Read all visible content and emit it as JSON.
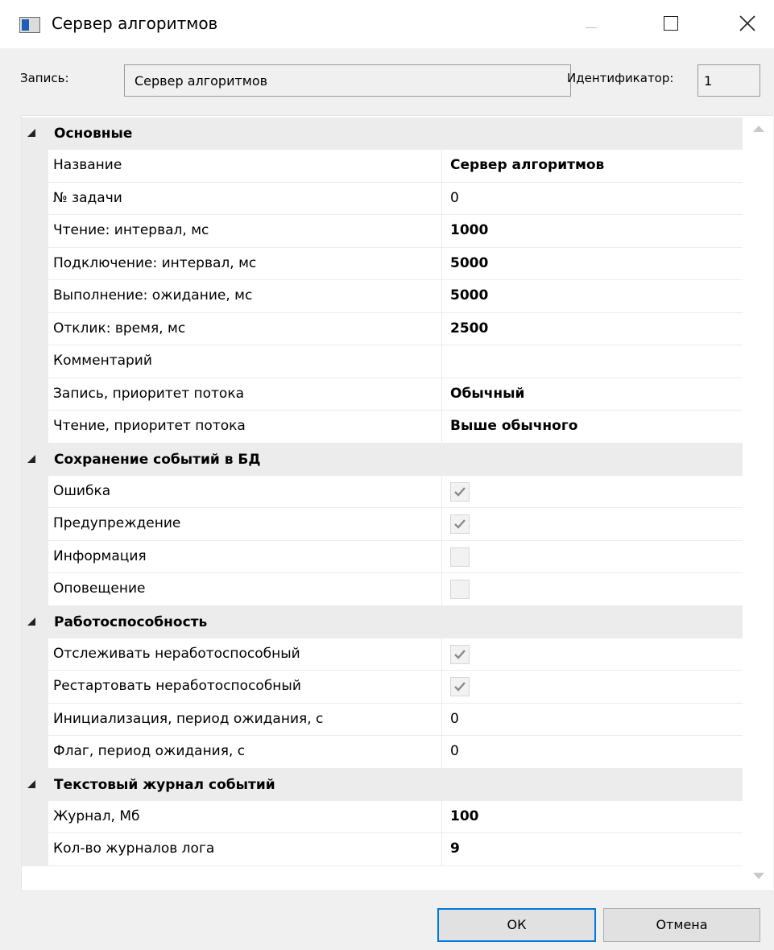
{
  "window": {
    "title": "Сервер алгоритмов",
    "icon": "app-window-icon",
    "controls": [
      "minimize-icon",
      "maximize-icon",
      "close-icon"
    ]
  },
  "record": {
    "label": "Запись:",
    "value": "Сервер алгоритмов",
    "id_label": "Идентификатор:",
    "id_value": "1"
  },
  "categories": [
    {
      "label": "Основные",
      "rows": [
        {
          "name": "Название",
          "value": "Сервер алгоритмов",
          "bold": true
        },
        {
          "name": "№ задачи",
          "value": "0",
          "bold": false
        },
        {
          "name": "Чтение: интервал, мс",
          "value": "1000",
          "bold": true
        },
        {
          "name": "Подключение: интервал, мс",
          "value": "5000",
          "bold": true
        },
        {
          "name": "Выполнение: ожидание, мс",
          "value": "5000",
          "bold": true
        },
        {
          "name": "Отклик: время, мс",
          "value": "2500",
          "bold": true
        },
        {
          "name": "Комментарий",
          "value": "",
          "bold": false
        },
        {
          "name": "Запись, приоритет потока",
          "value": "Обычный",
          "bold": true
        },
        {
          "name": "Чтение, приоритет потока",
          "value": "Выше обычного",
          "bold": true
        }
      ]
    },
    {
      "label": "Сохранение событий в БД",
      "rows": [
        {
          "name": "Ошибка",
          "checkbox": true,
          "checked": true
        },
        {
          "name": "Предупреждение",
          "checkbox": true,
          "checked": true
        },
        {
          "name": "Информация",
          "checkbox": true,
          "checked": false
        },
        {
          "name": "Оповещение",
          "checkbox": true,
          "checked": false
        }
      ]
    },
    {
      "label": "Работоспособность",
      "rows": [
        {
          "name": "Отслеживать неработоспособный",
          "checkbox": true,
          "checked": true
        },
        {
          "name": "Рестартовать неработоспособный",
          "checkbox": true,
          "checked": true
        },
        {
          "name": "Инициализация, период ожидания, с",
          "value": "0",
          "bold": false
        },
        {
          "name": "Флаг, период ожидания, с",
          "value": "0",
          "bold": false
        }
      ]
    },
    {
      "label": "Текстовый журнал событий",
      "rows": [
        {
          "name": "Журнал, Мб",
          "value": "100",
          "bold": true
        },
        {
          "name": "Кол-во журналов лога",
          "value": "9",
          "bold": true
        }
      ]
    }
  ],
  "buttons": {
    "ok": "ОК",
    "cancel": "Отмена"
  },
  "colors": {
    "accent": "#0078d7",
    "category_bg": "#ececec",
    "window_bg": "#f0f0f0"
  }
}
